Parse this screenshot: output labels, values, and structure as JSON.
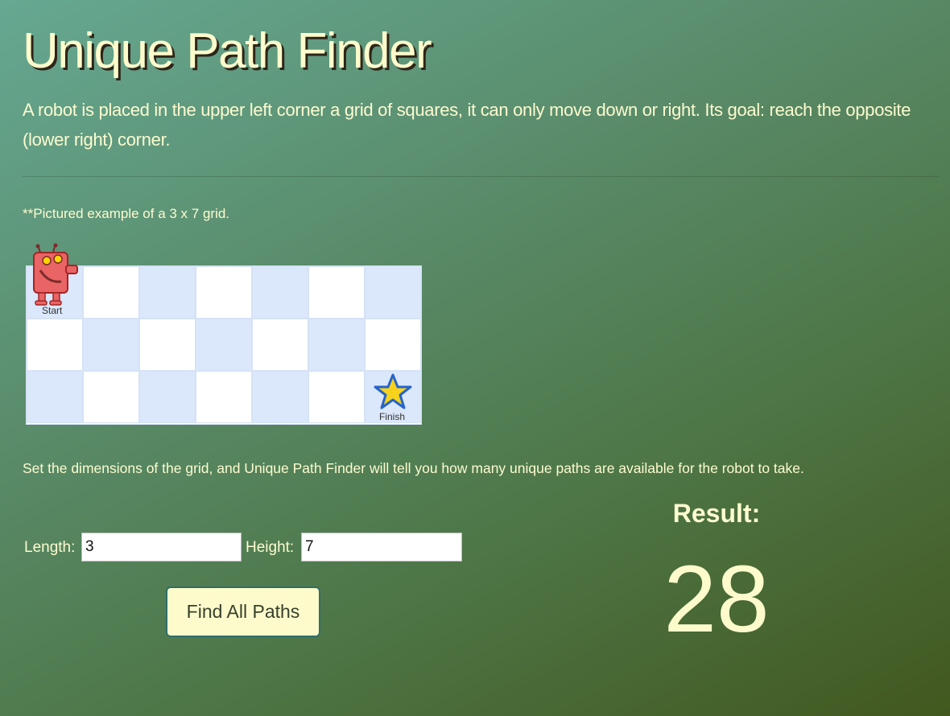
{
  "header": {
    "title": "Unique Path Finder",
    "description": "A robot is placed in the upper left corner a grid of squares, it can only move down or right. Its goal: reach the opposite (lower right) corner."
  },
  "example": {
    "note": "**Pictured example of a 3 x 7 grid.",
    "rows": 3,
    "columns": 7,
    "start_label": "Start",
    "finish_label": "Finish",
    "start_icon": "robot-icon",
    "finish_icon": "star-icon",
    "cell_colors": {
      "blue": "#dbe7fb",
      "white": "#ffffff"
    }
  },
  "instructions": "Set the dimensions of the grid, and Unique Path Finder will tell you how many unique paths are available for the robot to take.",
  "form": {
    "length_label": "Length:",
    "length_value": "3",
    "height_label": "Height:",
    "height_value": "7",
    "submit_label": "Find All Paths"
  },
  "result": {
    "heading": "Result:",
    "value": "28"
  },
  "colors": {
    "text": "#fdfbd0",
    "background_start": "#66a892",
    "background_end": "#42581f",
    "button_border": "#2f6e6a"
  }
}
